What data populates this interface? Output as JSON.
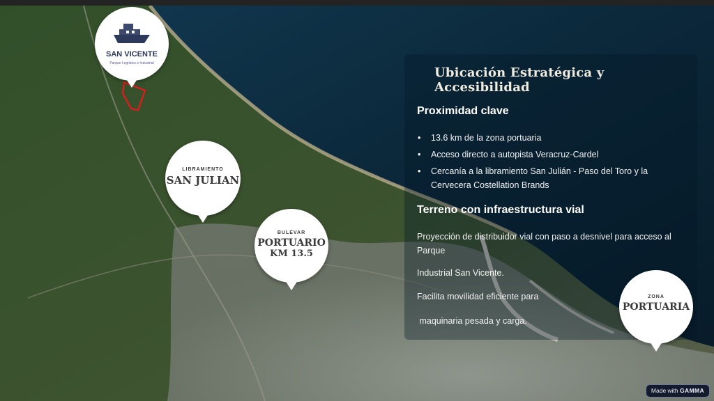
{
  "slide": {
    "title": "Ubicación Estratégica y Accesibilidad",
    "section1": {
      "heading": "Proximidad clave",
      "bullets": [
        "13.6 km de la zona portuaria",
        "Acceso directo a autopista Veracruz-Cardel",
        "Cercanía a la libramiento San Julián - Paso del Toro y la Cervecera Costellation Brands"
      ]
    },
    "section2": {
      "heading": "Terreno con infraestructura vial",
      "paragraphs": [
        "Proyección de distribuidor vial con paso a desnivel para acceso al Parque",
        "Industrial San Vicente.",
        "Facilita movilidad eficiente para",
        " maquinaria pesada y carga."
      ]
    }
  },
  "map_markers": {
    "san_vicente": {
      "name": "SAN VICENTE",
      "tagline": "Parque Logístico e Industrial"
    },
    "san_julian": {
      "small": "LIBRAMIENTO",
      "big": "SAN JULIAN"
    },
    "bulevar": {
      "small": "BULEVAR",
      "line1": "PORTUARIO",
      "line2": "KM 13.5"
    },
    "zona_portuaria": {
      "small": "ZONA",
      "big": "PORTUARIA"
    }
  },
  "badge": {
    "prefix": "Made with",
    "brand": "GAMMA"
  },
  "colors": {
    "sea": "#0c2a3e",
    "land": "#2f4a27",
    "city": "#8a8f88",
    "marker_outline": "#d41f1f",
    "badge_bg": "#141b2d"
  }
}
